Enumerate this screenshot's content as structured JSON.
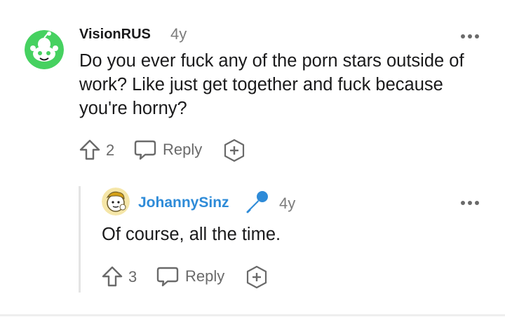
{
  "comment": {
    "username": "VisionRUS",
    "age": "4y",
    "text": "Do you ever fuck any of the porn stars outside of work? Like just get together and fuck because you're horny?",
    "upvotes": "2",
    "reply_label": "Reply",
    "avatar_icon": "reddit-snoo-avatar-icon",
    "avatar_color": "#46d160"
  },
  "reply": {
    "username": "JohannySinz",
    "age": "4y",
    "text": "Of course, all the time.",
    "upvotes": "3",
    "reply_label": "Reply",
    "badge_icon": "microphone-icon",
    "username_color": "#2e8bd8",
    "avatar_icon": "cartoon-avatar-icon"
  }
}
